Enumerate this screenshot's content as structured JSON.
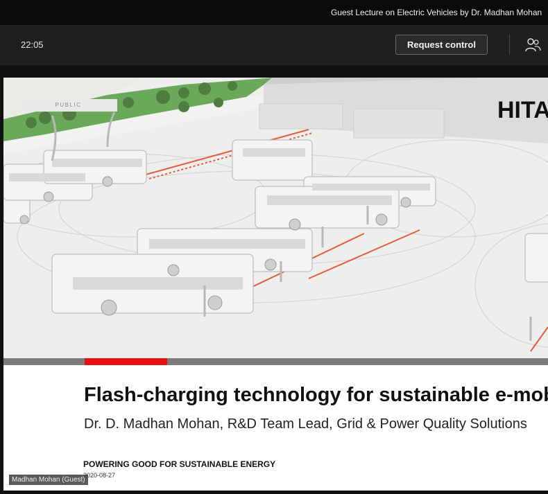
{
  "meeting": {
    "title": "Guest Lecture on Electric Vehicles by Dr. Madhan Mohan",
    "elapsed_time": "22:05"
  },
  "toolbar": {
    "request_control_label": "Request control",
    "people_icon": "people-icon"
  },
  "slide": {
    "classification_label": "PUBLIC",
    "brand_text": "HITACHI",
    "title": "Flash-charging technology for sustainable e-mobility",
    "subtitle": "Dr. D. Madhan Mohan, R&D Team Lead, Grid & Power Quality Solutions",
    "tagline": "POWERING GOOD FOR SUSTAINABLE ENERGY",
    "date": "2020-08-27",
    "accent_color": "#e60f0f"
  },
  "presenter": {
    "name": "Madhan Mohan (Guest)"
  }
}
